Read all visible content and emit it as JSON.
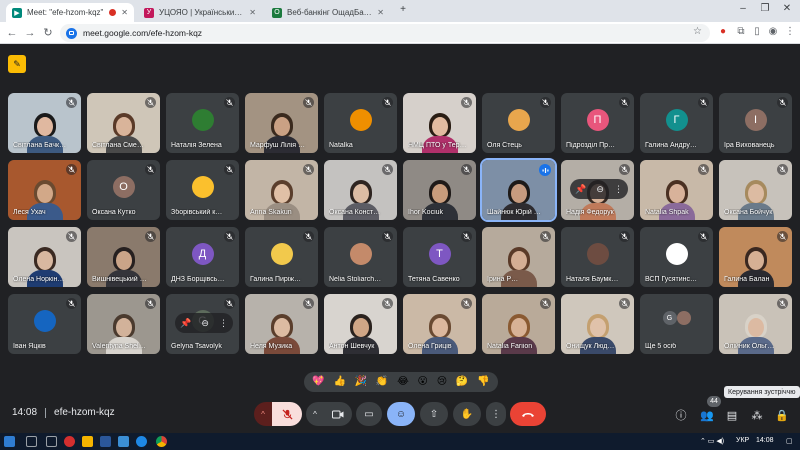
{
  "tabs": [
    {
      "title": "Meet: \"efe-hzom-kqz\"",
      "active": true,
      "favicon_color": "#00897b",
      "favicon": "meet-icon"
    },
    {
      "title": "УЦОЯО | Український центр оці",
      "active": false,
      "favicon_color": "#c2185b",
      "favicon": "ucoyao-icon"
    },
    {
      "title": "Веб-банкінг ОщадБанк✔Реєстрація",
      "active": false,
      "favicon_color": "#1b7a3e",
      "favicon": "oschadbank-icon"
    }
  ],
  "toolbar": {
    "url": "meet.google.com/efe-hzom-kqz",
    "back": "←",
    "forward": "→",
    "reload": "↻",
    "new_tab": "+"
  },
  "meeting": {
    "time": "14:08",
    "code": "efe-hzom-kqz",
    "participant_count": "44",
    "tooltip": "Керування зустріччю"
  },
  "participants": [
    {
      "name": "Світлана Бачк…",
      "kind": "video",
      "bg": "#b9c4cc",
      "skin": "#e0b8a0",
      "hair": "#1a1a1a",
      "shirt": "#3d5a80",
      "row": 0,
      "col": 0
    },
    {
      "name": "Світлана Сме…",
      "kind": "video",
      "bg": "#cfc6b8",
      "skin": "#d9b49a",
      "hair": "#5a3a28",
      "shirt": "#4a4a4a",
      "row": 0,
      "col": 1
    },
    {
      "name": "Наталія Зелена",
      "kind": "avatar",
      "avatar_color": "#2e7d32",
      "letter": "",
      "row": 0,
      "col": 2
    },
    {
      "name": "Марфуш Лілія …",
      "kind": "video",
      "bg": "#a39382",
      "skin": "#caa184",
      "hair": "#3a2a1e",
      "shirt": "#2c2c34",
      "row": 0,
      "col": 3
    },
    {
      "name": "Natalka",
      "kind": "avatar",
      "avatar_color": "#ef8f00",
      "letter": "",
      "row": 0,
      "col": 4
    },
    {
      "name": "НМЦ ПТО у Тер…",
      "kind": "video",
      "bg": "#d6d0cb",
      "skin": "#e2bba0",
      "hair": "#2a1d14",
      "shirt": "#b0306a",
      "row": 0,
      "col": 5
    },
    {
      "name": "Оля Стець",
      "kind": "avatar",
      "avatar_color": "#e8a64d",
      "letter": "",
      "row": 0,
      "col": 6
    },
    {
      "name": "Підрозділ Пр…",
      "kind": "avatar",
      "avatar_color": "#e8567c",
      "letter": "П",
      "row": 0,
      "col": 7
    },
    {
      "name": "Галина Андру…",
      "kind": "avatar",
      "avatar_color": "#12908e",
      "letter": "Г",
      "row": 0,
      "col": 8
    },
    {
      "name": "Іра Вихованець",
      "kind": "avatar",
      "avatar_color": "#8d6e63",
      "letter": "І",
      "row": 0,
      "col": 9
    },
    {
      "name": "Леся Ухач",
      "kind": "video",
      "bg": "#a8582e",
      "skin": "#d2a888",
      "hair": "#6a4a30",
      "shirt": "#3b5a8a",
      "row": 1,
      "col": 0
    },
    {
      "name": "Оксана Кутко",
      "kind": "avatar",
      "avatar_color": "#8d6e63",
      "letter": "О",
      "row": 1,
      "col": 1
    },
    {
      "name": "Зборівський к…",
      "kind": "avatar",
      "avatar_color": "#fbc02d",
      "letter": "",
      "row": 1,
      "col": 2
    },
    {
      "name": "Anna Skakun",
      "kind": "video",
      "bg": "#c2b5a6",
      "skin": "#e0c0a6",
      "hair": "#5a3e2c",
      "shirt": "#9a8e82",
      "row": 1,
      "col": 3
    },
    {
      "name": "Оксана Конст…",
      "kind": "video",
      "bg": "#c4c2c0",
      "skin": "#dcbca4",
      "hair": "#2e2420",
      "shirt": "#5c5c64",
      "row": 1,
      "col": 4
    },
    {
      "name": "Ihor Kociuk",
      "kind": "video",
      "bg": "#8f8a85",
      "skin": "#c89c7c",
      "hair": "#1f1a18",
      "shirt": "#2e3138",
      "row": 1,
      "col": 5
    },
    {
      "name": "Шайнюк Юрій …",
      "kind": "video",
      "bg": "#7d8fa6",
      "skin": "#c79b7f",
      "hair": "#1e1a18",
      "shirt": "#2e2c30",
      "row": 1,
      "col": 6,
      "speaking": true
    },
    {
      "name": "Надія Федорук",
      "kind": "video",
      "bg": "#b4aea6",
      "skin": "#d6b096",
      "hair": "#3a2a22",
      "shirt": "#c07a5a",
      "row": 1,
      "col": 7,
      "menu": true
    },
    {
      "name": "Natalia Shpak",
      "kind": "video",
      "bg": "#c8b9a8",
      "skin": "#d8b29a",
      "hair": "#4a3022",
      "shirt": "#8a6a9a",
      "row": 1,
      "col": 8
    },
    {
      "name": "Оксана Бойчук",
      "kind": "video",
      "bg": "#c7c2bb",
      "skin": "#dcbba2",
      "hair": "#a68a5e",
      "shirt": "#6a7a8a",
      "row": 1,
      "col": 9
    },
    {
      "name": "Олена Норкін…",
      "kind": "video",
      "bg": "#c9c5bf",
      "skin": "#d8b8a0",
      "hair": "#3a2a22",
      "shirt": "#1e3c72",
      "row": 2,
      "col": 0
    },
    {
      "name": "Вишнівецький …",
      "kind": "video",
      "bg": "#8a7a6c",
      "skin": "#caa488",
      "hair": "#262020",
      "shirt": "#34343a",
      "row": 2,
      "col": 1
    },
    {
      "name": "ДНЗ Борщівсь…",
      "kind": "avatar",
      "avatar_color": "#7e57c2",
      "letter": "Д",
      "row": 2,
      "col": 2
    },
    {
      "name": "Галина Пиріж…",
      "kind": "avatar",
      "avatar_color": "#f2c94c",
      "letter": "",
      "row": 2,
      "col": 3
    },
    {
      "name": "Nelia Stoliarch…",
      "kind": "avatar",
      "avatar_color": "#c48a6a",
      "letter": "",
      "row": 2,
      "col": 4
    },
    {
      "name": "Тетяна Савенко",
      "kind": "avatar",
      "avatar_color": "#7e57c2",
      "letter": "Т",
      "row": 2,
      "col": 5
    },
    {
      "name": "Ірина Р…",
      "kind": "video",
      "bg": "#b6aa9c",
      "skin": "#d4ae94",
      "hair": "#5a3a28",
      "shirt": "#7a5a4a",
      "row": 2,
      "col": 6
    },
    {
      "name": "Наталя Баумк…",
      "kind": "avatar",
      "avatar_color": "#6d4c41",
      "letter": "",
      "row": 2,
      "col": 7
    },
    {
      "name": "ВСП Гусятинс…",
      "kind": "avatar",
      "avatar_color": "#ffffff",
      "letter": "",
      "row": 2,
      "col": 8
    },
    {
      "name": "Галина Балан",
      "kind": "video",
      "bg": "#c08a5c",
      "skin": "#d6b094",
      "hair": "#3a2820",
      "shirt": "#2a2a30",
      "row": 2,
      "col": 9
    },
    {
      "name": "Іван Яцків",
      "kind": "avatar",
      "avatar_color": "#1565c0",
      "letter": "",
      "row": 3,
      "col": 0
    },
    {
      "name": "Valentyna Shel…",
      "kind": "video",
      "bg": "#9c978f",
      "skin": "#d2b29a",
      "hair": "#4a3a2e",
      "shirt": "#d8d4ce",
      "row": 3,
      "col": 1
    },
    {
      "name": "Gelyna Tsavolyk",
      "kind": "avatar",
      "avatar_color": "#5d6b5c",
      "letter": "G",
      "row": 3,
      "col": 2,
      "menu": true
    },
    {
      "name": "Неля Музика",
      "kind": "video",
      "bg": "#b7b2ab",
      "skin": "#dcbba2",
      "hair": "#5a3e2c",
      "shirt": "#7a4a3a",
      "row": 3,
      "col": 3
    },
    {
      "name": "Антон Шевчук",
      "kind": "video",
      "bg": "#d8d4cf",
      "skin": "#d0a686",
      "hair": "#2a221e",
      "shirt": "#2e2e34",
      "row": 3,
      "col": 4
    },
    {
      "name": "Олена Гриців",
      "kind": "video",
      "bg": "#cbb9a6",
      "skin": "#dcb89e",
      "hair": "#6a4a32",
      "shirt": "#4a5a7a",
      "row": 3,
      "col": 5
    },
    {
      "name": "Natalia Fariion",
      "kind": "video",
      "bg": "#b9aa99",
      "skin": "#d8b296",
      "hair": "#8a5a32",
      "shirt": "#5a3a4a",
      "row": 3,
      "col": 6
    },
    {
      "name": "Онищук Люд…",
      "kind": "video",
      "bg": "#cfc7bc",
      "skin": "#e0c2aa",
      "hair": "#c4a070",
      "shirt": "#3a4a6a",
      "row": 3,
      "col": 7
    },
    {
      "name": "Ще 5 осіб",
      "kind": "more",
      "row": 3,
      "col": 8
    },
    {
      "name": "Олійник Ольг…",
      "kind": "video",
      "bg": "#c9c2b8",
      "skin": "#dcbaa2",
      "hair": "#d8d2c8",
      "shirt": "#5a6a8a",
      "row": 3,
      "col": 9
    }
  ],
  "reactions": [
    "💖",
    "👍",
    "🎉",
    "👏",
    "😂",
    "😮",
    "😢",
    "🤔",
    "👎"
  ],
  "taskbar": {
    "lang": "УКР",
    "clock": "14:08"
  },
  "colors": {
    "meet_bg": "#202124",
    "tile_bg": "#3c4043",
    "end_call": "#ea4335",
    "accent": "#8ab4f8"
  }
}
